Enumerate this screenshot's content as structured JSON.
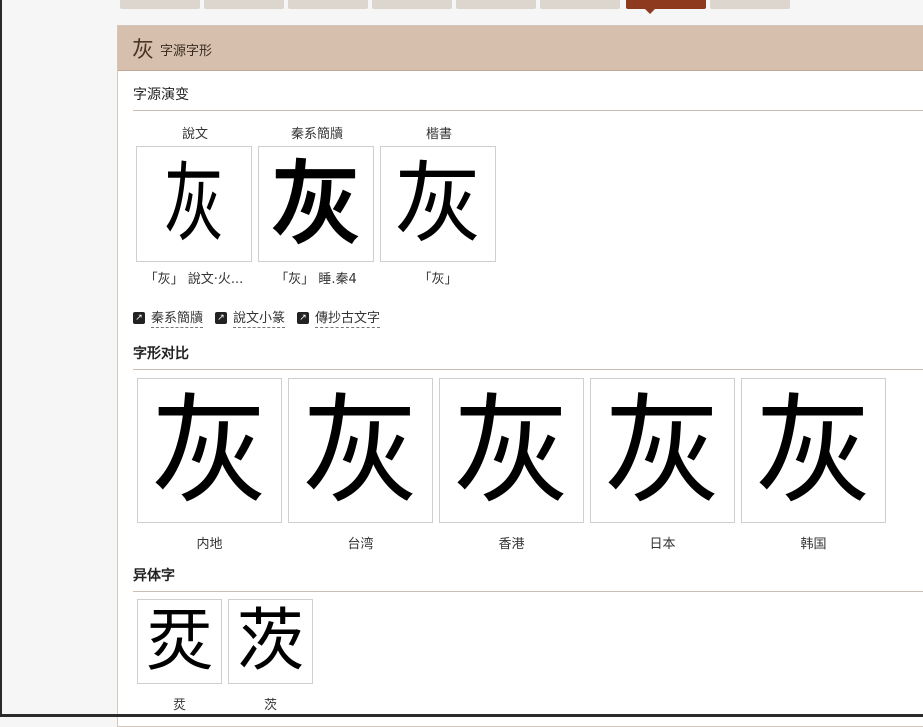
{
  "header": {
    "char": "灰",
    "title": "字源字形"
  },
  "evolution": {
    "title": "字源演变",
    "items": [
      {
        "label": "說文",
        "glyph": "灰",
        "caption": "「灰」 說文·火..."
      },
      {
        "label": "秦系簡牘",
        "glyph": "灰",
        "caption": "「灰」 睡.秦4"
      },
      {
        "label": "楷書",
        "glyph": "灰",
        "caption": "「灰」"
      }
    ],
    "links": [
      "秦系簡牘",
      "說文小篆",
      "傳抄古文字"
    ]
  },
  "comparison": {
    "title": "字形对比",
    "items": [
      {
        "glyph": "灰",
        "region": "内地"
      },
      {
        "glyph": "灰",
        "region": "台湾"
      },
      {
        "glyph": "灰",
        "region": "香港"
      },
      {
        "glyph": "灰",
        "region": "日本"
      },
      {
        "glyph": "灰",
        "region": "韩国"
      }
    ]
  },
  "variants": {
    "title": "异体字",
    "items": [
      {
        "glyph": "烎",
        "label": "烎"
      },
      {
        "glyph": "茨",
        "label": "茨"
      }
    ]
  },
  "colors": {
    "header_bg": "#d6c0ad",
    "active_tab": "#8e3a1f"
  }
}
